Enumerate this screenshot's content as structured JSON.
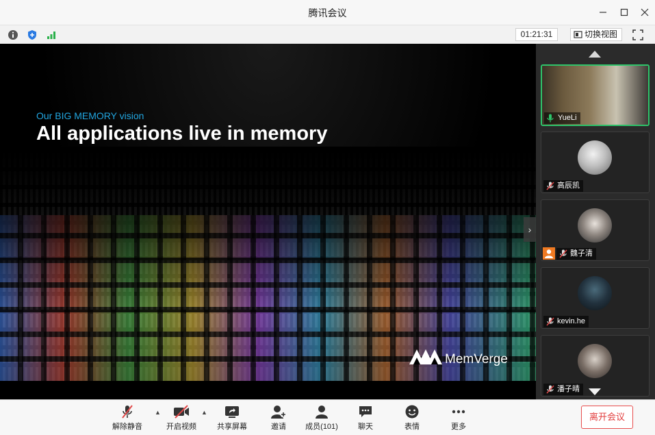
{
  "window": {
    "title": "腾讯会议"
  },
  "infobar": {
    "timer": "01:21:31",
    "switch_view_label": "切换视图",
    "icons": [
      "info-icon",
      "security-shield-icon",
      "network-signal-icon",
      "switch-view-icon",
      "fullscreen-icon"
    ]
  },
  "slide": {
    "subtitle": "Our BIG MEMORY vision",
    "title": "All applications live in memory",
    "logo_text": "MemVerge"
  },
  "participants": [
    {
      "name": "YueLi",
      "mic": "on",
      "video": true,
      "active_speaker": true
    },
    {
      "name": "高辰凯",
      "mic": "muted",
      "video": false
    },
    {
      "name": "魏子清",
      "mic": "muted",
      "video": false,
      "host_badge": true
    },
    {
      "name": "kevin.he",
      "mic": "muted",
      "video": false
    },
    {
      "name": "潘子晴",
      "mic": "muted",
      "video": false
    }
  ],
  "toolbar": {
    "unmute_label": "解除静音",
    "start_video_label": "开启视频",
    "share_screen_label": "共享屏幕",
    "invite_label": "邀请",
    "members_label": "成员(101)",
    "chat_label": "聊天",
    "reactions_label": "表情",
    "more_label": "更多",
    "leave_label": "离开会议"
  },
  "colors": {
    "accent_green": "#2ec46a",
    "leave_red": "#e23b3b",
    "mute_red": "#e04848",
    "slide_subtitle_blue": "#22a6e0"
  }
}
